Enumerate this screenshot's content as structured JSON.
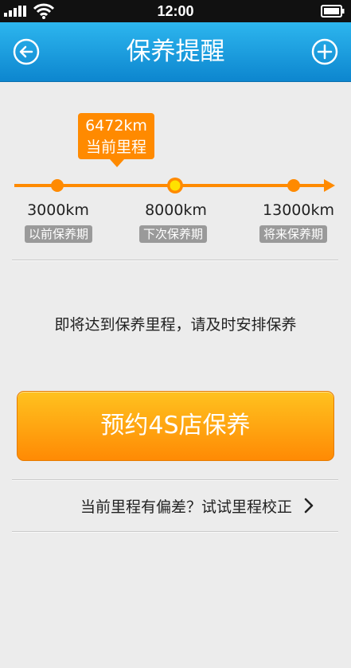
{
  "status_bar": {
    "time": "12:00"
  },
  "header": {
    "title": "保养提醒"
  },
  "timeline": {
    "current": {
      "value": "6472km",
      "label": "当前里程"
    },
    "marks": [
      {
        "value": "3000km",
        "tag": "以前保养期"
      },
      {
        "value": "8000km",
        "tag": "下次保养期"
      },
      {
        "value": "13000km",
        "tag": "将来保养期"
      }
    ]
  },
  "notice": "即将达到保养里程，请及时安排保养",
  "book_button": "预约4S店保养",
  "calibration_link": "当前里程有偏差？试试里程校正",
  "colors": {
    "accent": "#ff8a00",
    "header": "#1a9ee0"
  },
  "icons": [
    "signal-icon",
    "wifi-icon",
    "battery-icon",
    "back-icon",
    "add-icon",
    "chevron-right-icon"
  ]
}
